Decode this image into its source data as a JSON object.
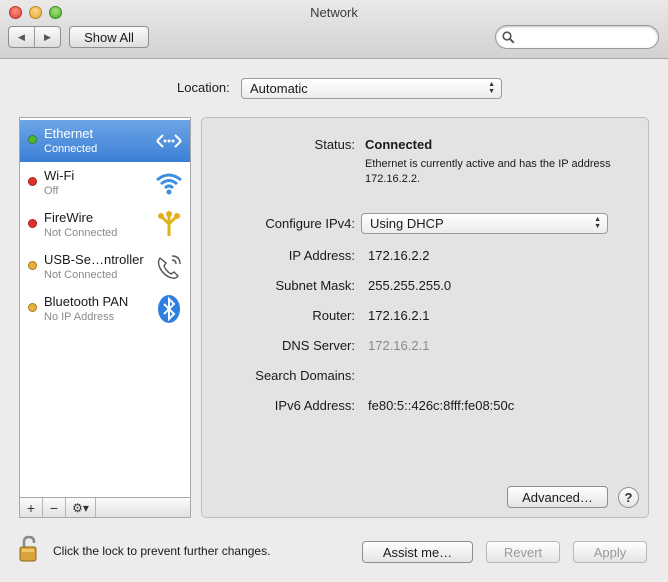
{
  "window": {
    "title": "Network"
  },
  "toolbar": {
    "back": "◀",
    "forward": "▶",
    "show_all": "Show All",
    "search_value": ""
  },
  "location": {
    "label": "Location:",
    "value": "Automatic"
  },
  "services": [
    {
      "name": "Ethernet",
      "status": "Connected",
      "dot": "#4cbb2f",
      "icon": "ethernet-arrows-icon",
      "selected": true
    },
    {
      "name": "Wi-Fi",
      "status": "Off",
      "dot": "#e0302a",
      "icon": "wifi-icon",
      "selected": false
    },
    {
      "name": "FireWire",
      "status": "Not Connected",
      "dot": "#e0302a",
      "icon": "firewire-icon",
      "selected": false
    },
    {
      "name": "USB-Se…ntroller",
      "status": "Not Connected",
      "dot": "#e8b13a",
      "icon": "phone-modem-icon",
      "selected": false
    },
    {
      "name": "Bluetooth PAN",
      "status": "No IP Address",
      "dot": "#e8b13a",
      "icon": "bluetooth-icon",
      "selected": false
    }
  ],
  "sidebar_toolbar": {
    "add": "+",
    "remove": "−",
    "gear": "⚙▾"
  },
  "detail": {
    "status_label": "Status:",
    "status_value": "Connected",
    "status_description": "Ethernet is currently active and has the IP address 172.16.2.2.",
    "configure_label": "Configure IPv4:",
    "configure_value": "Using DHCP",
    "ip_label": "IP Address:",
    "ip_value": "172.16.2.2",
    "subnet_label": "Subnet Mask:",
    "subnet_value": "255.255.255.0",
    "router_label": "Router:",
    "router_value": "172.16.2.1",
    "dns_label": "DNS Server:",
    "dns_value": "172.16.2.1",
    "search_domains_label": "Search Domains:",
    "search_domains_value": "",
    "ipv6_label": "IPv6 Address:",
    "ipv6_value": "fe80:5::426c:8fff:fe08:50c",
    "advanced": "Advanced…",
    "help": "?"
  },
  "footer": {
    "lock_text": "Click the lock to prevent further changes.",
    "assist": "Assist me…",
    "revert": "Revert",
    "apply": "Apply"
  },
  "colors": {
    "selection": "#3a7fd6",
    "connected": "#4cbb2f",
    "off": "#e0302a",
    "inactive": "#e8b13a"
  }
}
